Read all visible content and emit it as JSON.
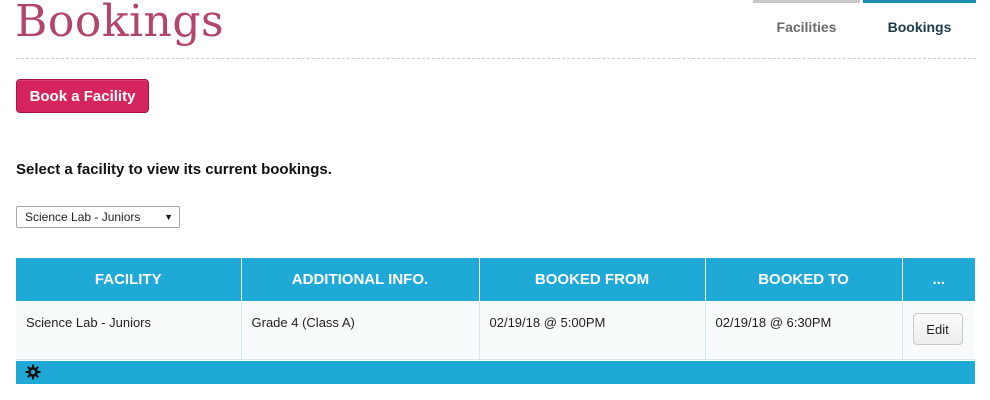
{
  "header": {
    "title": "Bookings"
  },
  "nav": {
    "tabs": [
      {
        "label": "Facilities",
        "active": false
      },
      {
        "label": "Bookings",
        "active": true
      }
    ]
  },
  "actions": {
    "book_label": "Book a Facility"
  },
  "filter": {
    "instruction": "Select a facility to view its current bookings.",
    "selected_facility": "Science Lab - Juniors"
  },
  "table": {
    "columns": [
      "FACILITY",
      "ADDITIONAL INFO.",
      "BOOKED FROM",
      "BOOKED TO",
      "..."
    ],
    "rows": [
      {
        "facility": "Science Lab - Juniors",
        "info": "Grade 4 (Class A)",
        "from": "02/19/18 @ 5:00PM",
        "to": "02/19/18 @ 6:30PM",
        "edit_label": "Edit"
      }
    ]
  },
  "footer": {
    "settings_icon": "gear-icon"
  },
  "colors": {
    "title": "#b2456b",
    "primary_button": "#d6245e",
    "table_header": "#1ea9d6",
    "active_tab_border": "#1c8ea9"
  }
}
